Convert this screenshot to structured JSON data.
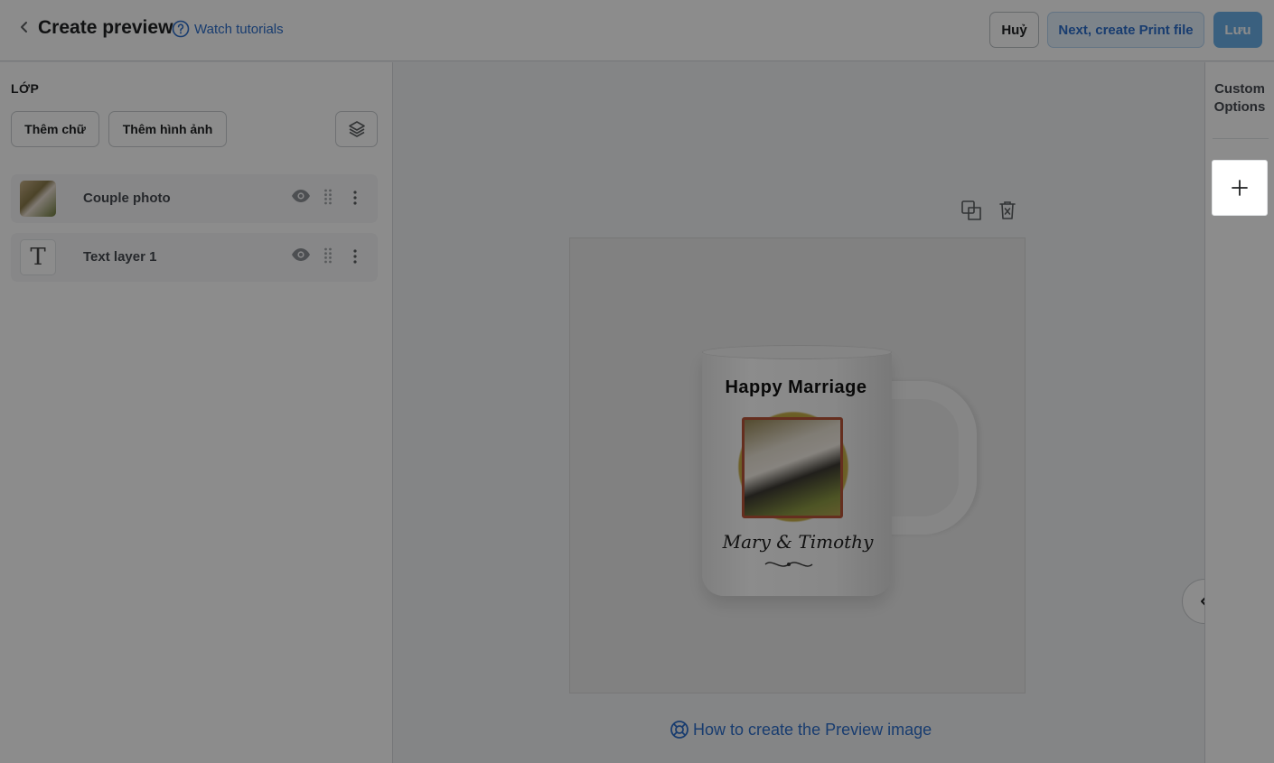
{
  "header": {
    "title": "Create preview",
    "tutorial_link": "Watch tutorials",
    "cancel_label": "Huỷ",
    "next_label": "Next, create Print file",
    "save_label": "Lưu"
  },
  "layers_panel": {
    "title": "LỚP",
    "add_text_label": "Thêm chữ",
    "add_image_label": "Thêm hình ảnh",
    "items": [
      {
        "name": "Couple photo",
        "type": "image"
      },
      {
        "name": "Text layer 1",
        "type": "text",
        "glyph": "T"
      }
    ]
  },
  "canvas": {
    "mug_title": "Happy Marriage",
    "mug_names": "Mary & Timothy",
    "help_link": "How to create the Preview image"
  },
  "custom_options": {
    "title": "Custom Options"
  },
  "colors": {
    "primary_link": "#2c6ecb",
    "save_button": "#6ab0e8",
    "overlay": "rgba(0,0,0,0.45)"
  },
  "icons": [
    "back-icon",
    "help-icon",
    "layers-stack-icon",
    "eye-icon",
    "drag-handle-icon",
    "more-icon",
    "duplicate-icon",
    "delete-icon",
    "lifebuoy-icon",
    "chevron-left-icon",
    "plus-icon"
  ]
}
